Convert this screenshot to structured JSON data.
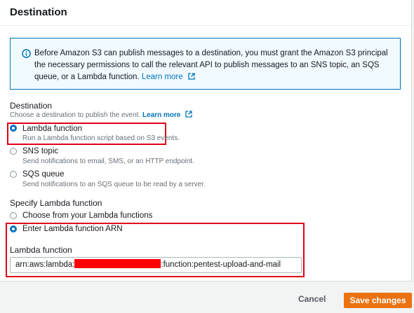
{
  "panel": {
    "title": "Destination"
  },
  "info": {
    "text": "Before Amazon S3 can publish messages to a destination, you must grant the Amazon S3 principal the necessary permissions to call the relevant API to publish messages to an SNS topic, an SQS queue, or a Lambda function.",
    "link": "Learn more"
  },
  "destination": {
    "label": "Destination",
    "description": "Choose a destination to publish the event.",
    "learn_more": "Learn more",
    "options": [
      {
        "label": "Lambda function",
        "description": "Run a Lambda function script based on S3 events.",
        "selected": true
      },
      {
        "label": "SNS topic",
        "description": "Send notifications to email, SMS, or an HTTP endpoint.",
        "selected": false
      },
      {
        "label": "SQS queue",
        "description": "Send notifications to an SQS queue to be read by a server.",
        "selected": false
      }
    ]
  },
  "specify": {
    "label": "Specify Lambda function",
    "options": [
      {
        "label": "Choose from your Lambda functions",
        "selected": false
      },
      {
        "label": "Enter Lambda function ARN",
        "selected": true
      }
    ],
    "field_label": "Lambda function",
    "arn_prefix": "arn:aws:lambda:",
    "arn_suffix": ":function:pentest-upload-and-mail"
  },
  "footer": {
    "cancel": "Cancel",
    "save": "Save changes"
  },
  "colors": {
    "accent": "#0073bb",
    "primary_button": "#ec7211",
    "highlight": "#e0001a",
    "redaction": "#ff0000"
  },
  "icons": {
    "info": "info-circle-icon",
    "external": "external-link-icon"
  }
}
